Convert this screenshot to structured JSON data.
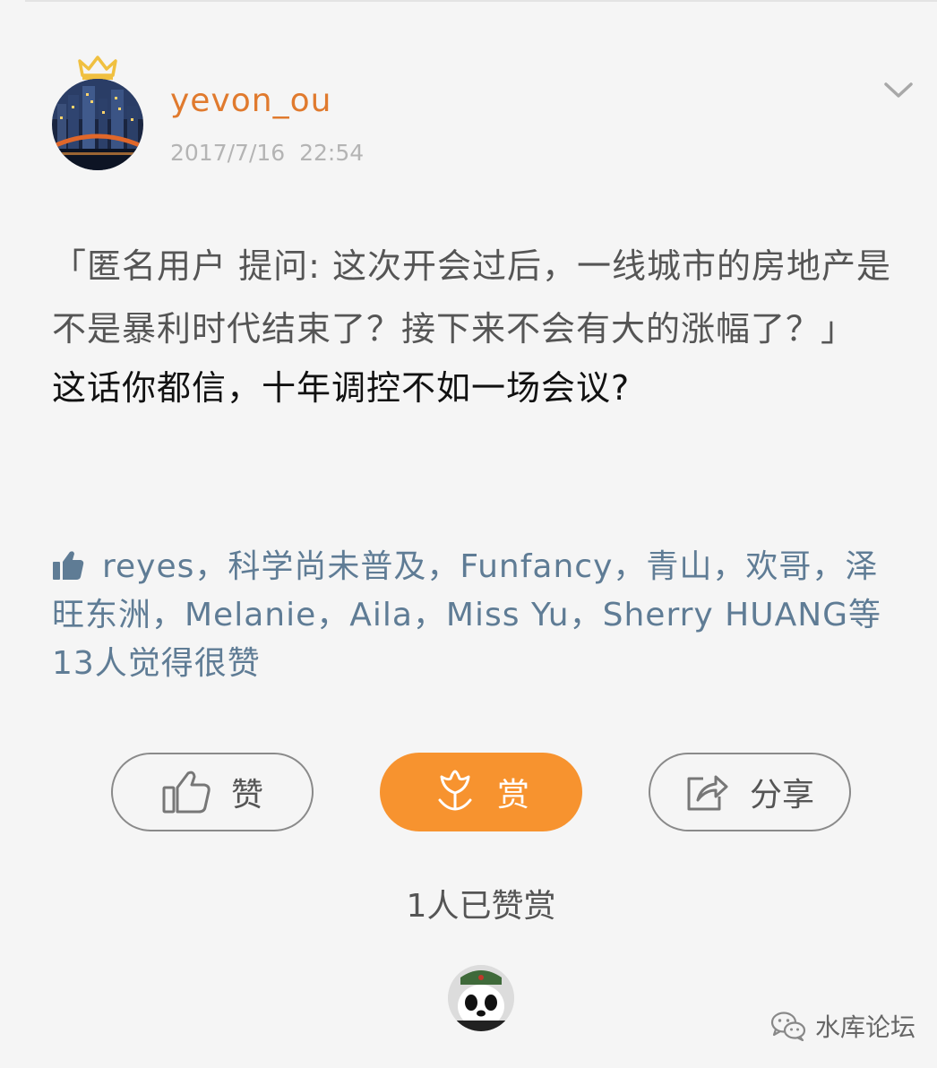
{
  "post": {
    "username": "yevon_ou",
    "timestamp": "2017/7/16  22:54",
    "quote": "「匿名用户  提问: 这次开会过后，一线城市的房地产是不是暴利时代结束了？接下来不会有大的涨幅了？」",
    "reply": "这话你都信，十年调控不如一场会议?"
  },
  "likes": {
    "text": "reyes，科学尚未普及，Funfancy，青山，欢哥，泽旺东洲，Melanie，Aila，Miss  Yu，Sherry HUANG等13人觉得很赞"
  },
  "actions": {
    "like_label": "赞",
    "reward_label": "赏",
    "share_label": "分享"
  },
  "reward_count": "1人已赞赏",
  "watermark": "水库论坛",
  "colors": {
    "username": "#e07a2e",
    "accent": "#f7932f",
    "likes": "#5f7c95",
    "background": "#f5f5f5"
  },
  "icons": {
    "crown": "crown-icon",
    "more": "chevron-down-icon",
    "likes": "thumbs-up-icon",
    "like": "thumbs-up-outline-icon",
    "reward": "tulip-icon",
    "share": "share-icon",
    "watermark": "wechat-icon"
  }
}
